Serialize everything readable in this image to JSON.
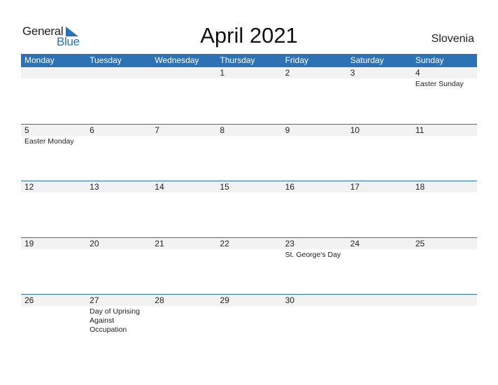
{
  "logo": {
    "general": "General",
    "blue": "Blue"
  },
  "title": "April 2021",
  "country": "Slovenia",
  "colors": {
    "accent": "#2e72b6",
    "day_bg": "#f2f2f2"
  },
  "weekdays": [
    "Monday",
    "Tuesday",
    "Wednesday",
    "Thursday",
    "Friday",
    "Saturday",
    "Sunday"
  ],
  "weeks": [
    {
      "days": [
        "",
        "",
        "",
        "1",
        "2",
        "3",
        "4"
      ],
      "events": [
        "",
        "",
        "",
        "",
        "",
        "",
        "Easter Sunday"
      ]
    },
    {
      "days": [
        "5",
        "6",
        "7",
        "8",
        "9",
        "10",
        "11"
      ],
      "events": [
        "Easter Monday",
        "",
        "",
        "",
        "",
        "",
        ""
      ]
    },
    {
      "days": [
        "12",
        "13",
        "14",
        "15",
        "16",
        "17",
        "18"
      ],
      "events": [
        "",
        "",
        "",
        "",
        "",
        "",
        ""
      ]
    },
    {
      "days": [
        "19",
        "20",
        "21",
        "22",
        "23",
        "24",
        "25"
      ],
      "events": [
        "",
        "",
        "",
        "",
        "St. George's Day",
        "",
        ""
      ]
    },
    {
      "days": [
        "26",
        "27",
        "28",
        "29",
        "30",
        "",
        ""
      ],
      "events": [
        "",
        "Day of Uprising Against Occupation",
        "",
        "",
        "",
        "",
        ""
      ]
    }
  ]
}
